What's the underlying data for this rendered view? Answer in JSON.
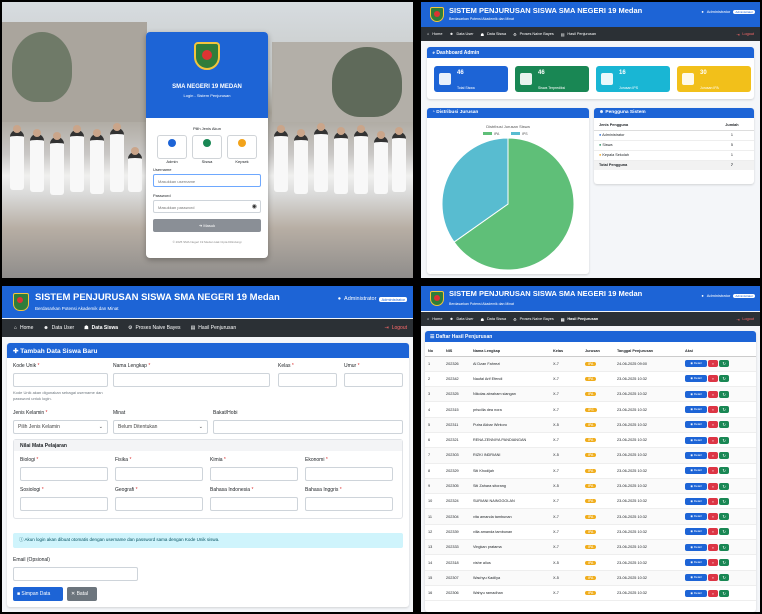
{
  "login": {
    "title": "SMA NEGERI 19 MEDAN",
    "subtitle": "Login - Sistem Penjurusan",
    "role_prompt": "Pilih Jenis Akun",
    "roles": [
      "Admin",
      "Siswa",
      "Kepsek"
    ],
    "username_label": "Username",
    "username_placeholder": "Masukkan username",
    "password_label": "Password",
    "password_placeholder": "Masukkan password",
    "submit": "Masuk",
    "footer": "© 2025 SMA Negeri 19 Medan Hak Cipta Dilindungi"
  },
  "app": {
    "title": "SISTEM PENJURUSAN SISWA SMA NEGERI 19 Medan",
    "tagline": "Berdasarkan Potensi Akademik dan Minat",
    "user": "Administrator",
    "role_badge": "Administrator",
    "nav": [
      "Home",
      "Data User",
      "Data Siswa",
      "Proses Naive Bayes",
      "Hasil Penjurusan"
    ],
    "logout": "Logout"
  },
  "dashboard": {
    "header": "Dashboard Admin",
    "stats": [
      {
        "value": "46",
        "label": "Total Siswa",
        "color": "#1d64d6"
      },
      {
        "value": "46",
        "label": "Siswa Terprediksi",
        "color": "#198754"
      },
      {
        "value": "16",
        "label": "Jurusan IPS",
        "color": "#19b6d4"
      },
      {
        "value": "30",
        "label": "Jurusan IPA",
        "color": "#f2c01a"
      }
    ],
    "distribution_header": "Distribusi Jurusan",
    "users_header": "Pengguna Sistem",
    "users_col1": "Jenis Pengguna",
    "users_col2": "Jumlah",
    "users": [
      {
        "type": "Administrator",
        "count": "1"
      },
      {
        "type": "Siswa",
        "count": "5"
      },
      {
        "type": "Kepala Sekolah",
        "count": "1"
      }
    ],
    "users_total_label": "Total Pengguna",
    "users_total": "7"
  },
  "chart_data": {
    "type": "pie",
    "title": "Distribusi Jurusan Siswa",
    "legend": [
      "IPA",
      "IPS"
    ],
    "values": [
      30,
      16
    ],
    "colors": [
      "#5fbf78",
      "#58bcd0"
    ]
  },
  "form": {
    "header": "Tambah Data Siswa Baru",
    "kode_label": "Kode Unik",
    "kode_help": "Kode Unik akan digunakan sebagai username dan password untuk login.",
    "nama_label": "Nama Lengkap",
    "kelas_label": "Kelas",
    "umur_label": "Umur",
    "jk_label": "Jenis Kelamin",
    "jk_value": "Pilih Jenis Kelamin",
    "minat_label": "Minat",
    "minat_value": "Belum Ditentukan",
    "bakat_label": "Bakat/Hobi",
    "nilai_header": "Nilai Mata Pelajaran",
    "subjects_row1": [
      "Biologi",
      "Fisika",
      "Kimia",
      "Ekonomi"
    ],
    "subjects_row2": [
      "Sosiologi",
      "Geografi",
      "Bahasa Indonesia",
      "Bahasa Inggris"
    ],
    "info": "Akun login akan dibuat otomatis dengan username dan password sama dengan Kode Unik siswa.",
    "email_label": "Email (Opsional)",
    "save": "Simpan Data",
    "cancel": "Batal"
  },
  "results": {
    "header": "Daftar Hasil Penjurusan",
    "columns": [
      "No",
      "NIS",
      "Nama Lengkap",
      "Kelas",
      "Jurusan",
      "Tanggal Penjurusan",
      "Aksi"
    ],
    "detail_label": "Detail",
    "rows": [
      [
        "1",
        "202326",
        "Al Dzan Fahrezi",
        "X-7",
        "IPA",
        "24-06-2025 09:00"
      ],
      [
        "2",
        "202342",
        "Naufal Arif Efendi",
        "X-7",
        "IPA",
        "23-06-2025 10:32"
      ],
      [
        "3",
        "202325",
        "Nikolas abraham siangan",
        "X-7",
        "IPA",
        "23-06-2025 10:32"
      ],
      [
        "4",
        "202315",
        "priscilla dea nora",
        "X-7",
        "IPS",
        "23-06-2025 10:32"
      ],
      [
        "5",
        "202311",
        "Putra Akbar Wintoro",
        "X-5",
        "IPA",
        "23-06-2025 10:32"
      ],
      [
        "6",
        "202321",
        "RENA ZENNIYA PANDIANGAN",
        "X-7",
        "IPA",
        "23-06-2025 10:32"
      ],
      [
        "7",
        "202303",
        "RIZKI INDRIANI",
        "X-5",
        "IPA",
        "23-06-2025 10:32"
      ],
      [
        "8",
        "202329",
        "Siti Khodijah",
        "X-7",
        "IPA",
        "23-06-2025 10:32"
      ],
      [
        "9",
        "202305",
        "Siti Zahara sitorang",
        "X-5",
        "IPA",
        "23-06-2025 10:32"
      ],
      [
        "10",
        "202324",
        "SURIANI NAINGGOLAN",
        "X-7",
        "IPA",
        "23-06-2025 10:32"
      ],
      [
        "11",
        "202304",
        "vita amanda tambunan",
        "X-7",
        "IPA",
        "23-06-2025 10:32"
      ],
      [
        "12",
        "202339",
        "villa amanda tambunan",
        "X-7",
        "IPA",
        "23-06-2025 10:32"
      ],
      [
        "13",
        "202333",
        "Vingkan pratama",
        "X-7",
        "IPA",
        "23-06-2025 10:32"
      ],
      [
        "14",
        "202318",
        "vishe alius",
        "X-5",
        "IPA",
        "23-06-2025 10:32"
      ],
      [
        "15",
        "202307",
        "Wachyu Kadilya",
        "X-5",
        "IPA",
        "23-06-2025 10:32"
      ],
      [
        "16",
        "202306",
        "Wahyu ramadhan",
        "X-7",
        "IPA",
        "23-06-2025 10:32"
      ]
    ]
  }
}
